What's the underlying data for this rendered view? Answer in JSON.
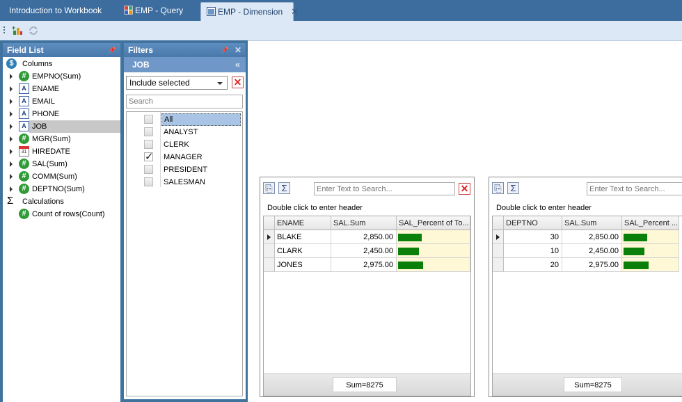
{
  "tabs": [
    {
      "label": "Introduction to Workbook",
      "active": false
    },
    {
      "label": "EMP - Query",
      "active": false
    },
    {
      "label": "EMP - Dimension",
      "active": true
    }
  ],
  "colors": {
    "accent": "#3d6d9f",
    "bar": "#0a7f0a",
    "pct_bg": "#fff8d6"
  },
  "field_list": {
    "title": "Field List",
    "columns_label": "Columns",
    "columns": [
      {
        "label": "EMPNO(Sum)",
        "icon": "hash-icon"
      },
      {
        "label": "ENAME",
        "icon": "text-field-icon"
      },
      {
        "label": "EMAIL",
        "icon": "text-field-icon"
      },
      {
        "label": "PHONE",
        "icon": "text-field-icon"
      },
      {
        "label": "JOB",
        "icon": "text-field-icon",
        "selected": true
      },
      {
        "label": "MGR(Sum)",
        "icon": "hash-icon"
      },
      {
        "label": "HIREDATE",
        "icon": "calendar-icon"
      },
      {
        "label": "SAL(Sum)",
        "icon": "hash-icon"
      },
      {
        "label": "COMM(Sum)",
        "icon": "hash-icon"
      },
      {
        "label": "DEPTNO(Sum)",
        "icon": "hash-icon"
      }
    ],
    "calculations_label": "Calculations",
    "calculations": [
      {
        "label": "Count of rows(Count)",
        "icon": "hash-icon"
      }
    ]
  },
  "filters": {
    "title": "Filters",
    "field": "JOB",
    "mode": "Include selected",
    "search_placeholder": "Search",
    "options": [
      {
        "label": "All",
        "checked": false,
        "selected": true
      },
      {
        "label": "ANALYST",
        "checked": false
      },
      {
        "label": "CLERK",
        "checked": false
      },
      {
        "label": "MANAGER",
        "checked": true
      },
      {
        "label": "PRESIDENT",
        "checked": false
      },
      {
        "label": "SALESMAN",
        "checked": false
      }
    ]
  },
  "cards": [
    {
      "search_placeholder": "Enter Text to Search...",
      "header_hint": "Double click to enter header",
      "columns": [
        "ENAME",
        "SAL.Sum",
        "SAL_Percent of To..."
      ],
      "rows": [
        {
          "key": "BLAKE",
          "sal": "2,850.00",
          "pct": 0.344
        },
        {
          "key": "CLARK",
          "sal": "2,450.00",
          "pct": 0.296
        },
        {
          "key": "JONES",
          "sal": "2,975.00",
          "pct": 0.36
        }
      ],
      "sum_label": "Sum=8275"
    },
    {
      "search_placeholder": "Enter Text to Search...",
      "header_hint": "Double click to enter header",
      "columns": [
        "DEPTNO",
        "SAL.Sum",
        "SAL_Percent ..."
      ],
      "rows": [
        {
          "key": "30",
          "sal": "2,850.00",
          "pct": 0.344
        },
        {
          "key": "10",
          "sal": "2,450.00",
          "pct": 0.296
        },
        {
          "key": "20",
          "sal": "2,975.00",
          "pct": 0.36
        }
      ],
      "sum_label": "Sum=8275"
    }
  ]
}
